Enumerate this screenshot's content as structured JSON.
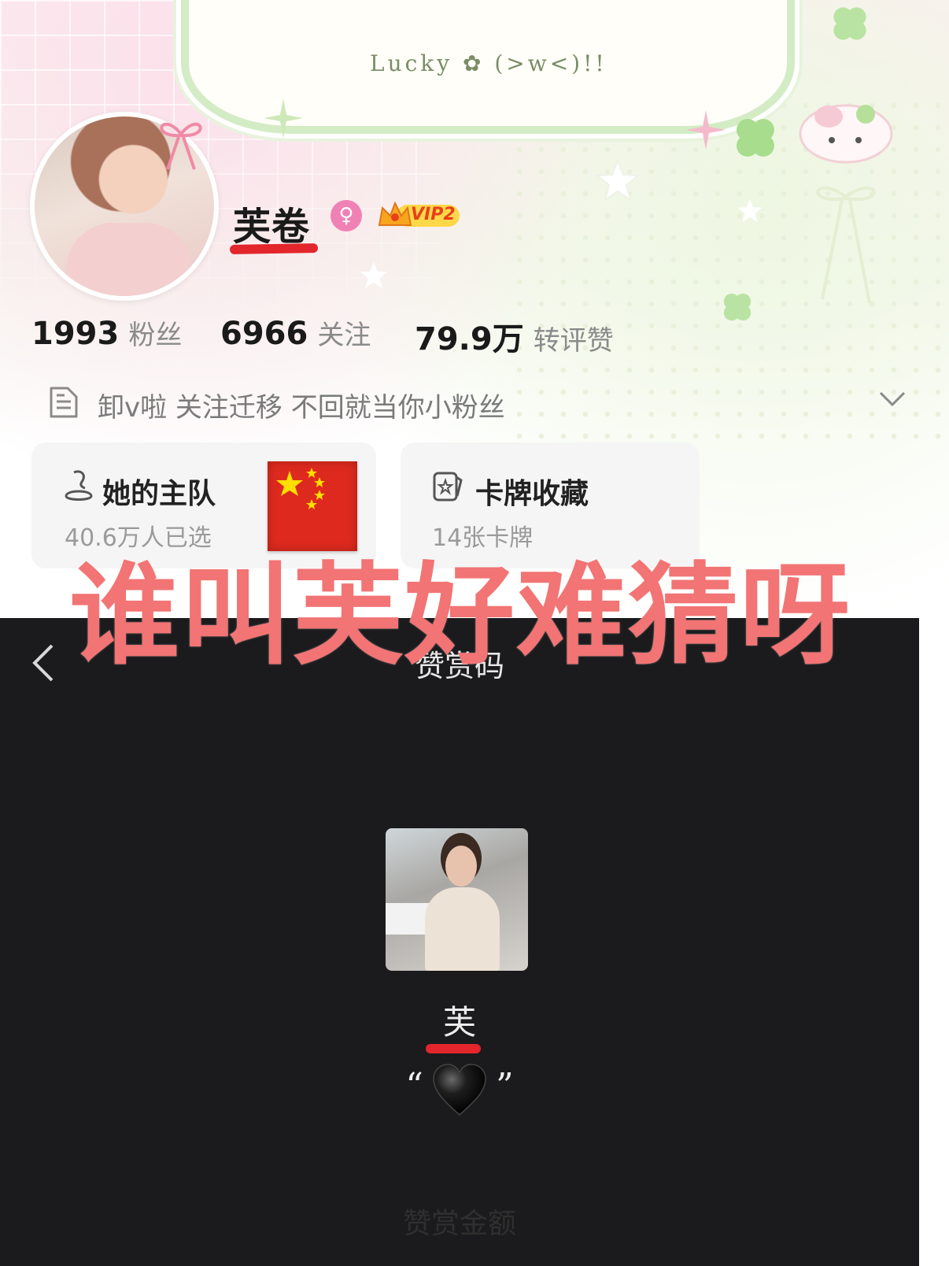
{
  "banner": {
    "lucky_text": "Lucky ✿ (>w<)!!"
  },
  "profile": {
    "name": "芙卷",
    "vip_label": "VIP2",
    "stats": [
      {
        "value": "1993",
        "label": "粉丝"
      },
      {
        "value": "6966",
        "label": "关注"
      },
      {
        "value": "79.9万",
        "label": "转评赞"
      }
    ],
    "bio": "卸v啦 关注迁移 不回就当你小粉丝"
  },
  "cards": {
    "team": {
      "title": "她的主队",
      "subtitle": "40.6万人已选"
    },
    "collection": {
      "title": "卡牌收藏",
      "subtitle": "14张卡牌"
    }
  },
  "overlay": {
    "caption": "谁叫芙好难猜呀"
  },
  "reward": {
    "title": "赞赏码",
    "name": "芙",
    "quote_open": "“",
    "quote_close": "”",
    "footer": "赞赏金额"
  },
  "colors": {
    "accent_red": "#e2262c",
    "overlay_pink": "#f27474",
    "dark_bg": "#1b1b1d",
    "gender_pink": "#f081b4"
  },
  "icons": {
    "gender": "female-icon",
    "vip": "crown-icon",
    "bio": "document-icon",
    "expand": "chevron-down-icon",
    "team": "trophy-icon",
    "collection": "card-star-icon",
    "back": "chevron-left-icon",
    "heart": "black-heart-icon"
  }
}
